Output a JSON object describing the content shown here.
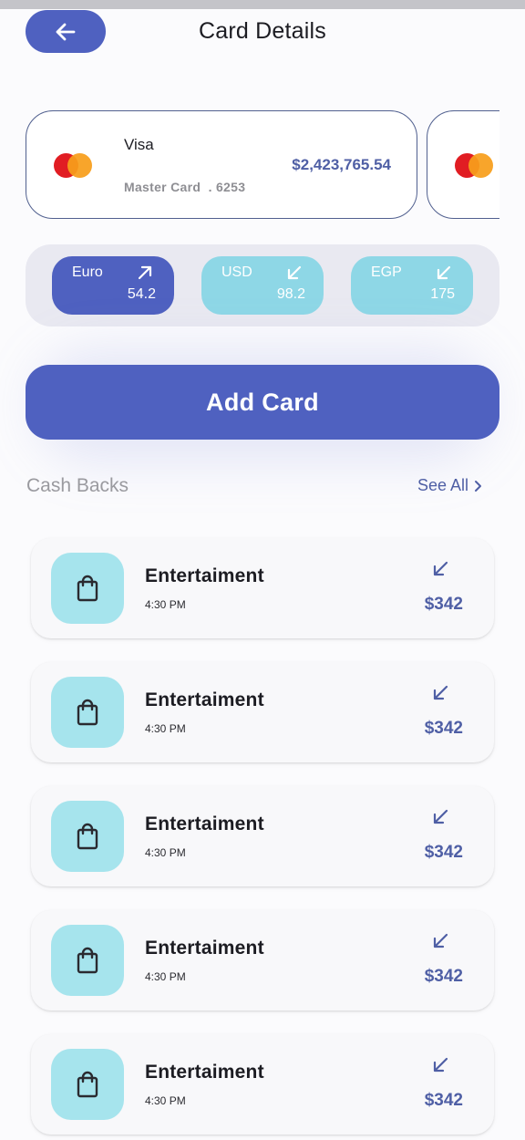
{
  "header": {
    "title": "Card Details",
    "back_icon": "arrow-left-icon"
  },
  "cards": [
    {
      "brand_icon": "mastercard-logo",
      "type": "Visa",
      "meta": "Master Card  . 6253",
      "amount": "$2,423,765.54"
    },
    {
      "brand_icon": "mastercard-logo"
    }
  ],
  "currencies": [
    {
      "name": "Euro",
      "value": "54.2",
      "direction": "arrow-up-right-icon",
      "active": true
    },
    {
      "name": "USD",
      "value": "98.2",
      "direction": "arrow-down-left-icon",
      "active": false
    },
    {
      "name": "EGP",
      "value": "175",
      "direction": "arrow-down-left-icon",
      "active": false
    }
  ],
  "add_card": {
    "label": "Add Card"
  },
  "cash_backs": {
    "title": "Cash Backs",
    "see_all": "See All",
    "items": [
      {
        "icon": "shopping-bag-icon",
        "title": "Entertaiment",
        "time": "4:30 PM",
        "amount": "$342",
        "direction": "arrow-down-left-icon"
      },
      {
        "icon": "shopping-bag-icon",
        "title": "Entertaiment",
        "time": "4:30 PM",
        "amount": "$342",
        "direction": "arrow-down-left-icon"
      },
      {
        "icon": "shopping-bag-icon",
        "title": "Entertaiment",
        "time": "4:30 PM",
        "amount": "$342",
        "direction": "arrow-down-left-icon"
      },
      {
        "icon": "shopping-bag-icon",
        "title": "Entertaiment",
        "time": "4:30 PM",
        "amount": "$342",
        "direction": "arrow-down-left-icon"
      },
      {
        "icon": "shopping-bag-icon",
        "title": "Entertaiment",
        "time": "4:30 PM",
        "amount": "$342",
        "direction": "arrow-down-left-icon"
      }
    ]
  },
  "colors": {
    "primary": "#4f61c0",
    "accent_light": "#8ed7e6",
    "amount_text": "#4f5fa5",
    "background": "#fbfbfd"
  }
}
